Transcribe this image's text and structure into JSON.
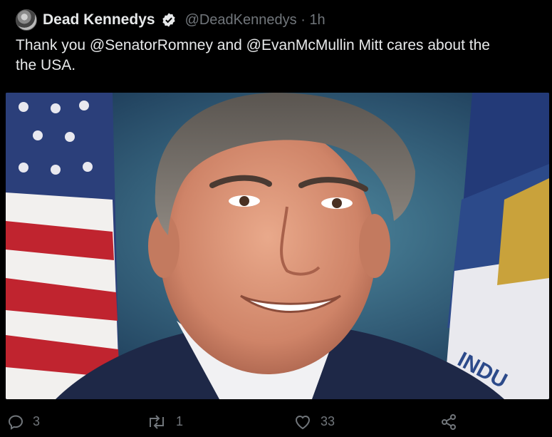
{
  "tweet": {
    "display_name": "Dead Kennedys",
    "handle": "@DeadKennedys",
    "separator": "·",
    "time": "1h",
    "text_line1": "Thank you @SenatorRomney  and @EvanMcMullin   Mitt cares about the",
    "text_line2": "the USA."
  },
  "media": {
    "flag_text": "INDU"
  },
  "actions": {
    "reply_count": "3",
    "retweet_count": "1",
    "like_count": "33"
  },
  "icons": [
    "verified-badge-icon",
    "reply-icon",
    "retweet-icon",
    "like-icon",
    "share-icon"
  ],
  "colors": {
    "background": "#000000",
    "text": "#e7e9ea",
    "secondary": "#71767b"
  }
}
